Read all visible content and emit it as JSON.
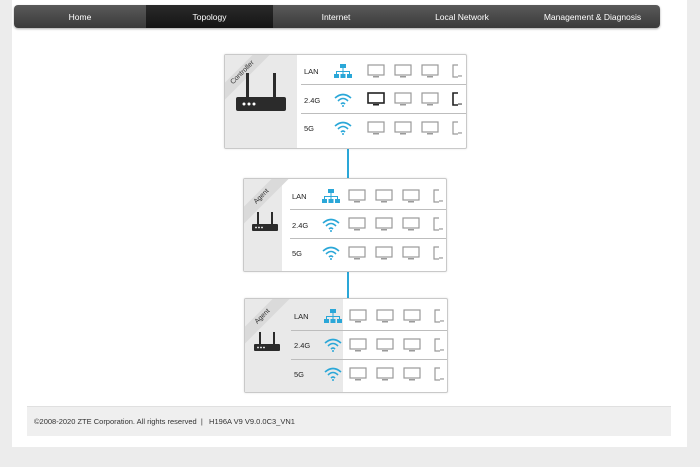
{
  "nav": {
    "items": [
      {
        "label": "Home",
        "active": false
      },
      {
        "label": "Topology",
        "active": true
      },
      {
        "label": "Internet",
        "active": false
      },
      {
        "label": "Local Network",
        "active": false
      },
      {
        "label": "Management & Diagnosis",
        "active": false
      }
    ]
  },
  "topology": {
    "controller": {
      "role": "Controller",
      "rows": [
        {
          "label": "LAN",
          "icon": "lan-icon"
        },
        {
          "label": "2.4G",
          "icon": "wifi-icon"
        },
        {
          "label": "5G",
          "icon": "wifi-icon"
        }
      ]
    },
    "agent1": {
      "role": "Agent",
      "rows": [
        {
          "label": "LAN",
          "icon": "lan-icon"
        },
        {
          "label": "2.4G",
          "icon": "wifi-icon"
        },
        {
          "label": "5G",
          "icon": "wifi-icon"
        }
      ]
    },
    "agent2": {
      "role": "Agent",
      "rows": [
        {
          "label": "LAN",
          "icon": "lan-icon"
        },
        {
          "label": "2.4G",
          "icon": "wifi-icon"
        },
        {
          "label": "5G",
          "icon": "wifi-icon"
        }
      ]
    }
  },
  "colors": {
    "accent": "#2aa7d8",
    "nav_bg": "#4a4a4a",
    "nav_active": "#1c1c1c"
  },
  "footer": {
    "copyright": "©2008-2020 ZTE Corporation. All rights reserved  |   H196A V9 V9.0.0C3_VN1"
  }
}
